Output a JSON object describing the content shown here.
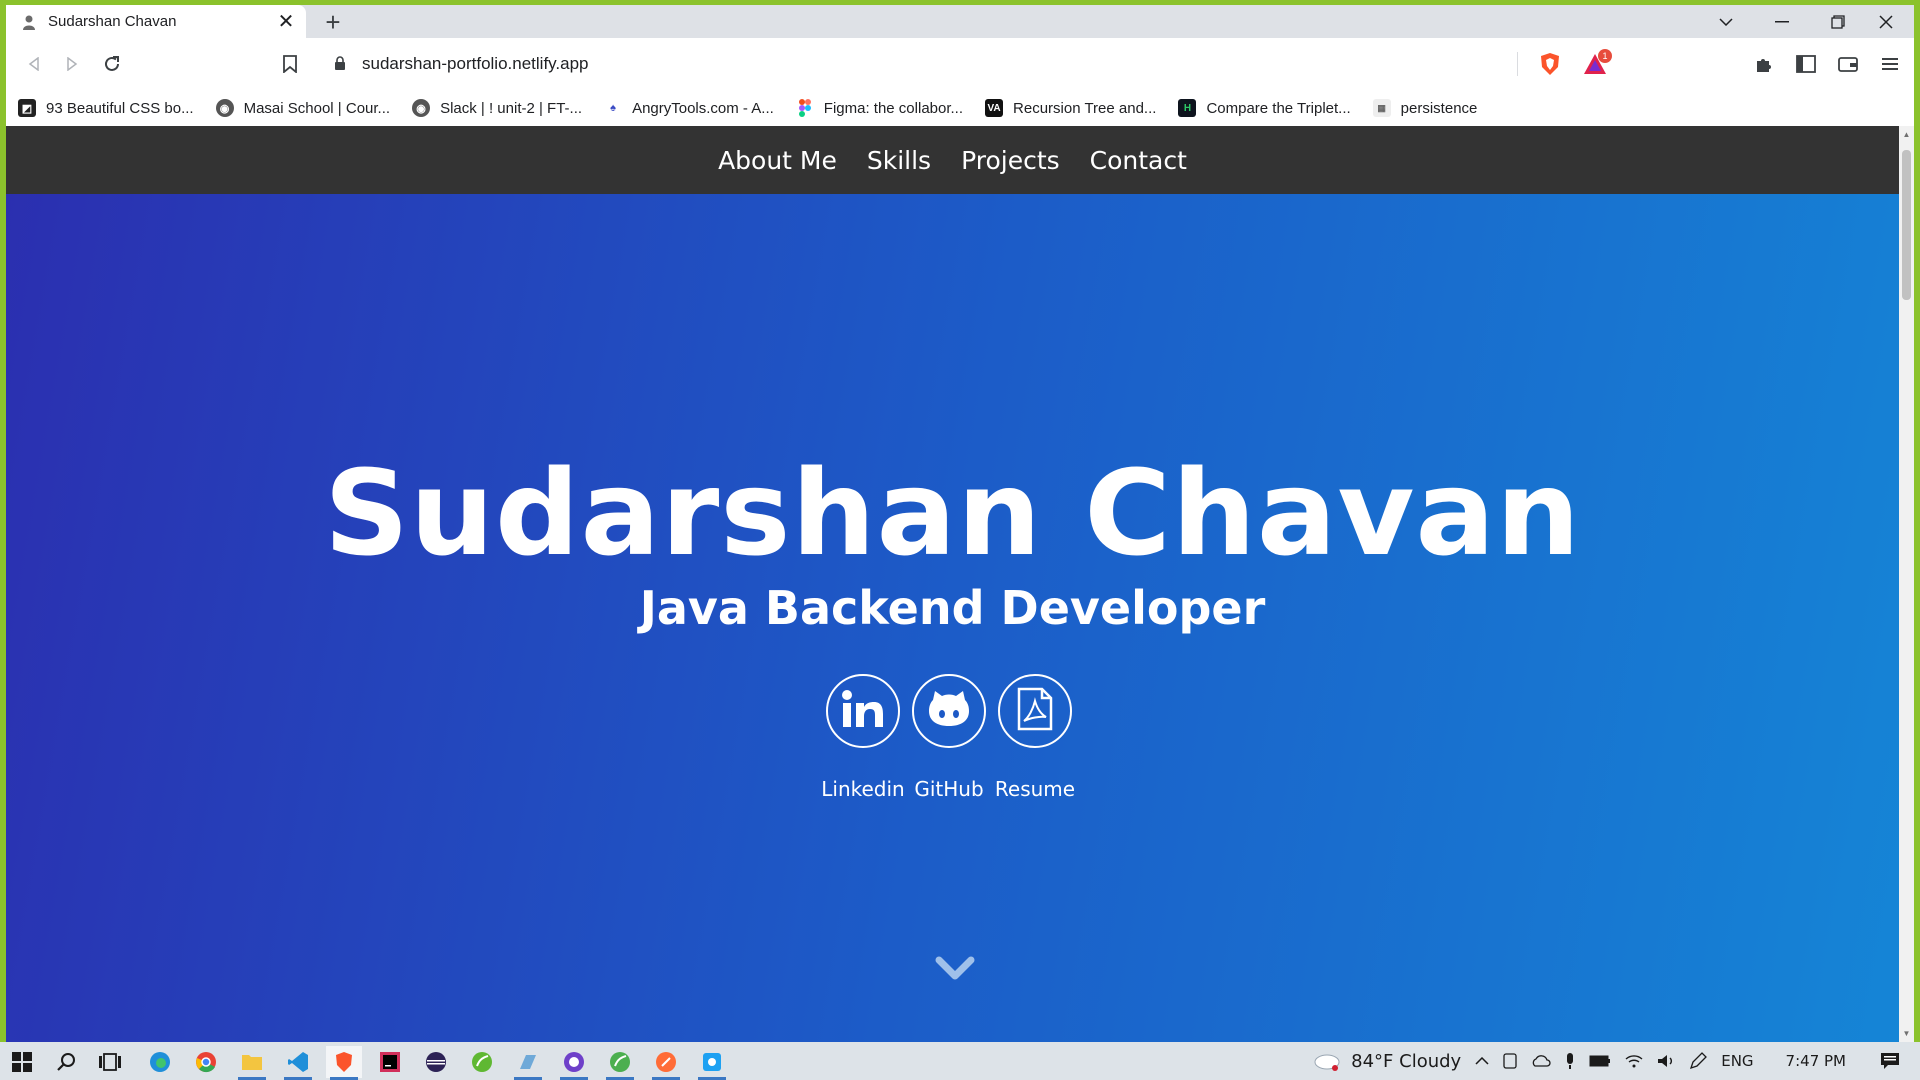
{
  "tab": {
    "title": "Sudarshan Chavan",
    "close": "✕",
    "new_tab": "+"
  },
  "window_controls": {
    "dropdown": "⌄",
    "minimize": "—",
    "restore": "❐",
    "close": "✕"
  },
  "toolbar": {
    "url": "sudarshan-portfolio.netlify.app",
    "rewards_badge": "1"
  },
  "bookmarks": [
    {
      "label": "93 Beautiful CSS bo...",
      "icon": "codepen-icon",
      "color": "#222222"
    },
    {
      "label": "Masai School | Cour...",
      "icon": "globe-icon",
      "color": "#555555"
    },
    {
      "label": "Slack | ! unit-2 | FT-...",
      "icon": "globe-icon",
      "color": "#555555"
    },
    {
      "label": "AngryTools.com - A...",
      "icon": "angrytools-icon",
      "color": "#3b4bc4"
    },
    {
      "label": "Figma: the collabor...",
      "icon": "figma-icon",
      "color": "#f24e1e"
    },
    {
      "label": "Recursion Tree and...",
      "icon": "va-icon",
      "color": "#111111"
    },
    {
      "label": "Compare the Triplet...",
      "icon": "hackerrank-icon",
      "color": "#0e141e"
    },
    {
      "label": "persistence",
      "icon": "baeldung-icon",
      "color": "#666666"
    }
  ],
  "site": {
    "nav": [
      "About Me",
      "Skills",
      "Projects",
      "Contact"
    ],
    "name": "Sudarshan Chavan",
    "role": "Java Backend Developer",
    "social": {
      "linkedin": "Linkedin",
      "github": "GitHub",
      "resume": "Resume"
    }
  },
  "taskbar": {
    "weather": "84°F  Cloudy",
    "lang": "ENG",
    "time": "7:47 PM"
  },
  "colors": {
    "hero_gradient_start": "#2b2fb0",
    "hero_gradient_end": "#1585d6",
    "site_nav_bg": "#333333",
    "window_border": "#8bc22c"
  }
}
